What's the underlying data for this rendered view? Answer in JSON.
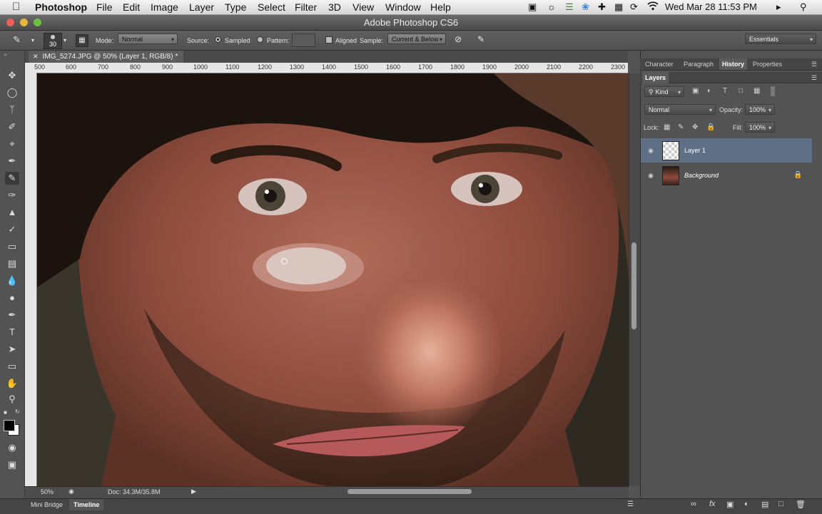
{
  "menubar": {
    "app_name": "Photoshop",
    "items": [
      "File",
      "Edit",
      "Image",
      "Layer",
      "Type",
      "Select",
      "Filter",
      "3D",
      "View",
      "Window",
      "Help"
    ],
    "clock": "Wed Mar 28  11:53 PM",
    "status_icons": [
      "camera-icon",
      "brightness-icon",
      "equalizer-icon",
      "flower-icon",
      "medical-cross-icon",
      "puzzle-icon",
      "sync-icon",
      "wifi-icon",
      "speaker-icon",
      "search-icon"
    ]
  },
  "window": {
    "title": "Adobe Photoshop CS6"
  },
  "options": {
    "brush_size": "30",
    "mode_label": "Mode:",
    "mode_value": "Normal",
    "source_label": "Source:",
    "sampled_label": "Sampled",
    "pattern_label": "Pattern:",
    "aligned_label": "Aligned",
    "sample_label": "Sample:",
    "sample_value": "Current & Below",
    "workspace": "Essentials"
  },
  "document": {
    "tab_title": "IMG_5274.JPG @ 50% (Layer 1, RGB/8) *",
    "ruler_ticks": [
      "500",
      "600",
      "700",
      "800",
      "900",
      "1000",
      "1100",
      "1200",
      "1300",
      "1400",
      "1500",
      "1600",
      "1700",
      "1800",
      "1900",
      "2000",
      "2100",
      "2200",
      "2300"
    ],
    "zoom": "50%",
    "doc_size": "Doc: 34.3M/35.8M"
  },
  "bottom_tabs": [
    "Mini Bridge",
    "Timeline"
  ],
  "panels": {
    "tabs": [
      "Character",
      "Paragraph",
      "History",
      "Properties"
    ],
    "active_tab": "History",
    "layers_title": "Layers",
    "filter_kind": "Kind",
    "blend_mode": "Normal",
    "opacity_label": "Opacity:",
    "opacity_value": "100%",
    "lock_label": "Lock:",
    "fill_label": "Fill:",
    "fill_value": "100%",
    "layers": [
      {
        "name": "Layer 1",
        "selected": true
      },
      {
        "name": "Background",
        "selected": false
      }
    ]
  },
  "colors": {
    "selected_layer": "#5e6f86",
    "panel_bg": "#535353"
  }
}
